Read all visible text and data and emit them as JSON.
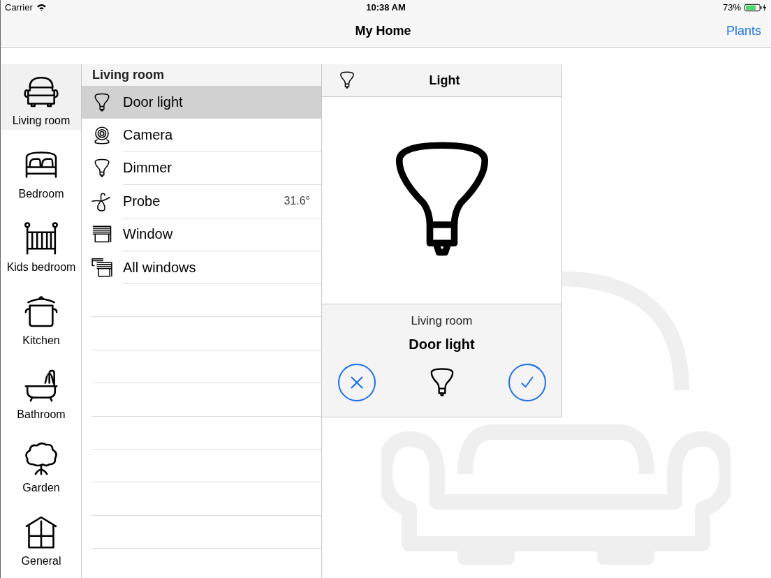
{
  "status_bar": {
    "carrier": "Carrier",
    "time": "10:38 AM",
    "battery": "73%"
  },
  "nav_bar": {
    "title": "My Home",
    "right_button": "Plants"
  },
  "rooms": [
    {
      "label": "Living room",
      "kind": "sofa",
      "selected": true
    },
    {
      "label": "Bedroom",
      "kind": "bed",
      "selected": false
    },
    {
      "label": "Kids bedroom",
      "kind": "crib",
      "selected": false
    },
    {
      "label": "Kitchen",
      "kind": "pot",
      "selected": false
    },
    {
      "label": "Bathroom",
      "kind": "bathtub",
      "selected": false
    },
    {
      "label": "Garden",
      "kind": "tree",
      "selected": false
    },
    {
      "label": "General",
      "kind": "house",
      "selected": false
    }
  ],
  "device_list": {
    "header": "Living room",
    "items": [
      {
        "label": "Door light",
        "kind": "bulb",
        "selected": true
      },
      {
        "label": "Camera",
        "kind": "camera",
        "selected": false
      },
      {
        "label": "Dimmer",
        "kind": "bulb",
        "selected": false
      },
      {
        "label": "Probe",
        "kind": "probe",
        "selected": false,
        "value": "31.6°"
      },
      {
        "label": "Window",
        "kind": "window",
        "selected": false
      },
      {
        "label": "All windows",
        "kind": "windows",
        "selected": false
      }
    ]
  },
  "detail": {
    "title": "Light",
    "kind": "bulb",
    "room": "Living room",
    "device": "Door light"
  }
}
